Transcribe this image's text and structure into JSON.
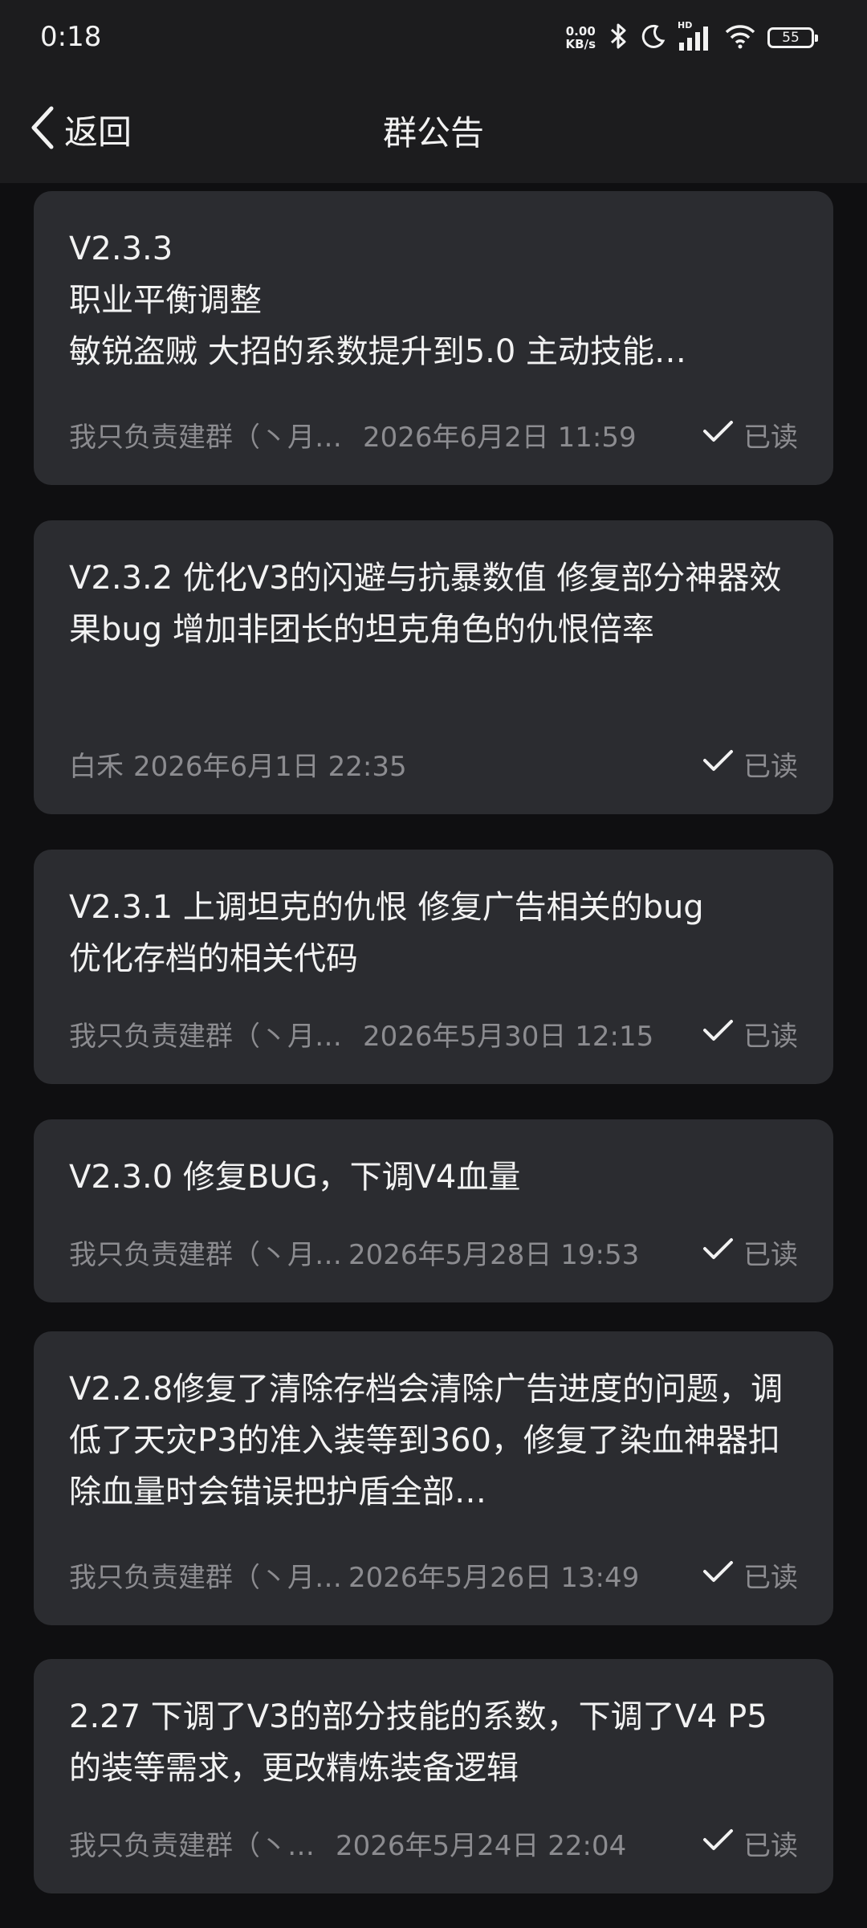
{
  "status_bar": {
    "time": "0:18",
    "net_speed_value": "0.00",
    "net_speed_unit": "KB/s",
    "network_label": "HD",
    "battery": "55",
    "icons": [
      "bluetooth-icon",
      "moon-icon",
      "signal-icon",
      "wifi-icon",
      "battery-icon"
    ]
  },
  "nav": {
    "back_label": "返回",
    "title": "群公告"
  },
  "announcements": [
    {
      "text": "V2.3.3\n职业平衡调整\n敏锐盗贼 大招的系数提升到5.0 主动技能…",
      "author": "我只负责建群（丶月…",
      "time": "2026年6月2日 11:59",
      "status": "已读"
    },
    {
      "text": "V2.3.2 优化V3的闪避与抗暴数值 修复部分神器效果bug 增加非团长的坦克角色的仇恨倍率",
      "author": "白禾",
      "time": "2026年6月1日 22:35",
      "status": "已读"
    },
    {
      "text": "V2.3.1 上调坦克的仇恨 修复广告相关的bug\n优化存档的相关代码",
      "author": "我只负责建群（丶月…",
      "time": "2026年5月30日 12:15",
      "status": "已读"
    },
    {
      "text": "V2.3.0 修复BUG，下调V4血量",
      "author": "我只负责建群（丶月…",
      "time": "2026年5月28日 19:53",
      "status": "已读"
    },
    {
      "text": "V2.2.8修复了清除存档会清除广告进度的问题，调低了天灾P3的准入装等到360，修复了染血神器扣除血量时会错误把护盾全部…",
      "author": "我只负责建群（丶月…",
      "time": "2026年5月26日 13:49",
      "status": "已读"
    },
    {
      "text": "2.27 下调了V3的部分技能的系数，下调了V4 P5的装等需求，更改精炼装备逻辑",
      "author": "我只负责建群（丶…",
      "time": "2026年5月24日 22:04",
      "status": "已读"
    }
  ],
  "colors": {
    "background": "#0f0f11",
    "bar": "#1c1c1e",
    "card": "#2b2c30",
    "meta_text": "#8c8c90"
  }
}
